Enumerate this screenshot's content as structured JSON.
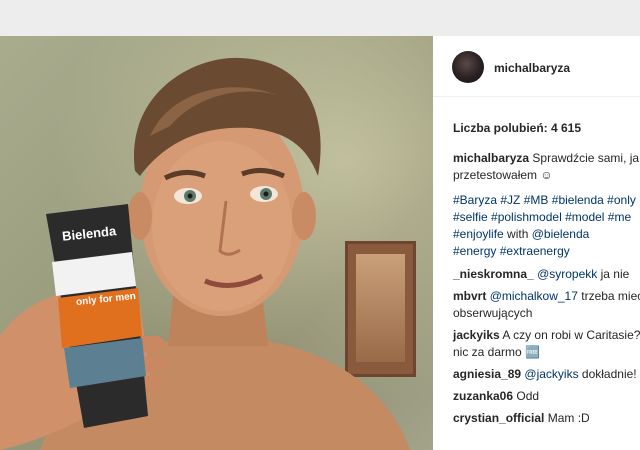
{
  "post": {
    "username": "michalbaryza",
    "likes_label": "Liczba polubień: 4 615",
    "caption": {
      "user": "michalbaryza",
      "line1": "Sprawdźcie sami, ja",
      "line2": "przetestowałem ☺"
    },
    "hashtags": [
      [
        "#Baryza",
        "#JZ",
        "#MB",
        "#bielenda",
        "#only"
      ],
      [
        "#selfie",
        "#polishmodel",
        "#model",
        "#me"
      ]
    ],
    "hashtag_line3": {
      "tag": "#enjoylife",
      "rest": "with",
      "mention": "@bielenda"
    },
    "hashtag_line4": [
      "#energy",
      "#extraenergy"
    ],
    "comments": [
      {
        "user": "_nieskromna_",
        "mention": "@syropekk",
        "text": "ja nie",
        "cont": ""
      },
      {
        "user": "mbvrt",
        "mention": "@michalkow_17",
        "text": "trzeba mieć",
        "cont": "obserwujących"
      },
      {
        "user": "jackyiks",
        "mention": "",
        "text": "A czy on robi w Caritasie?",
        "cont": "nic za darmo 🆓"
      },
      {
        "user": "agniesia_89",
        "mention": "@jackyiks",
        "text": "dokładnie!",
        "cont": ""
      },
      {
        "user": "zuzanka06",
        "mention": "",
        "text": "Odd",
        "cont": ""
      },
      {
        "user": "crystian_official",
        "mention": "",
        "text": "Mam :D",
        "cont": ""
      }
    ]
  },
  "photo": {
    "product_brand": "Bielenda",
    "product_line": "only for men"
  }
}
